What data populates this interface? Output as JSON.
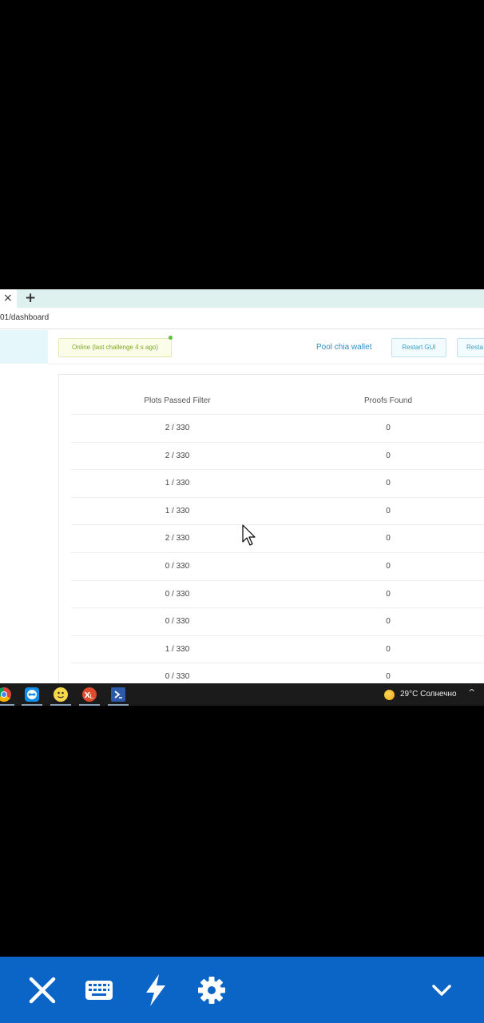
{
  "browser": {
    "tab_close": "×",
    "new_tab": "+",
    "url": "01/dashboard"
  },
  "header": {
    "status": "Online (last challenge 4 s ago)",
    "pool_wallet": "Pool chia wallet",
    "restart_gui": "Restart GUI",
    "restart_other": "Resta"
  },
  "table": {
    "columns": [
      "Plots Passed Filter",
      "Proofs Found"
    ],
    "rows": [
      [
        "2 / 330",
        "0"
      ],
      [
        "2 / 330",
        "0"
      ],
      [
        "1 / 330",
        "0"
      ],
      [
        "1 / 330",
        "0"
      ],
      [
        "2 / 330",
        "0"
      ],
      [
        "0 / 330",
        "0"
      ],
      [
        "0 / 330",
        "0"
      ],
      [
        "0 / 330",
        "0"
      ],
      [
        "1 / 330",
        "0"
      ],
      [
        "0 / 330",
        "0"
      ]
    ]
  },
  "taskbar": {
    "apps": [
      "chrome-icon",
      "teamviewer-icon",
      "emoji-app-icon",
      "xl-app-icon",
      "powershell-icon"
    ],
    "weather": "29°C  Солнечно",
    "tray_chevron": "^"
  },
  "remote_toolbar": {
    "buttons": [
      "close-icon",
      "keyboard-icon",
      "lightning-icon",
      "gear-icon",
      "chevron-down-icon"
    ],
    "accent": "#0a65c6"
  }
}
